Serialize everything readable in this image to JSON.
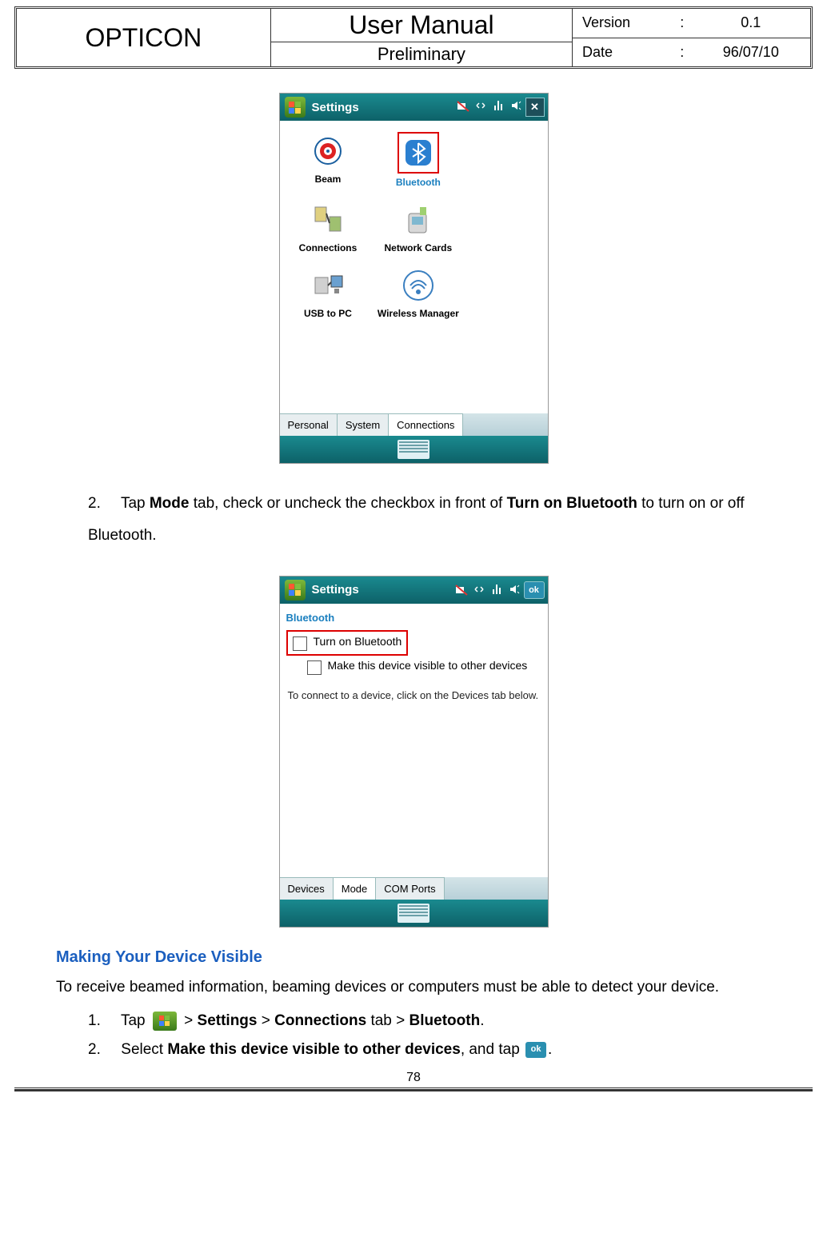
{
  "header": {
    "brand": "OPTICON",
    "title": "User Manual",
    "subtitle": "Preliminary",
    "version_label": "Version",
    "version_value": "0.1",
    "date_label": "Date",
    "date_value": "96/07/10"
  },
  "screenshot1": {
    "title": "Settings",
    "icons": [
      {
        "label": "Beam"
      },
      {
        "label": "Bluetooth"
      },
      {
        "label": "Connections"
      },
      {
        "label": "Network Cards"
      },
      {
        "label": "USB to PC"
      },
      {
        "label": "Wireless Manager"
      }
    ],
    "tabs": [
      "Personal",
      "System",
      "Connections"
    ]
  },
  "step2": {
    "num": "2.",
    "text_a": "Tap ",
    "bold_a": "Mode",
    "text_b": " tab, check or uncheck the checkbox in front of ",
    "bold_b": "Turn on Bluetooth",
    "text_c": " to turn on or off Bluetooth."
  },
  "screenshot2": {
    "title": "Settings",
    "subtitle": "Bluetooth",
    "opt1": "Turn on Bluetooth",
    "opt2": "Make this device visible to other devices",
    "note": "To connect to a device, click on the Devices tab below.",
    "tabs": [
      "Devices",
      "Mode",
      "COM Ports"
    ],
    "ok": "ok"
  },
  "section": {
    "title": "Making Your Device Visible",
    "intro": "To receive beamed information, beaming devices or computers must be able to detect your device.",
    "step1": {
      "num": "1.",
      "a": "Tap ",
      "gt1": " > ",
      "b": "Settings",
      "gt2": " > ",
      "c": "Connections",
      "d": " tab > ",
      "e": "Bluetooth",
      "f": "."
    },
    "step2": {
      "num": "2.",
      "a": "Select ",
      "b": "Make this device visible to other devices",
      "c": ", and tap ",
      "d": ".",
      "ok": "ok"
    }
  },
  "page_number": "78"
}
